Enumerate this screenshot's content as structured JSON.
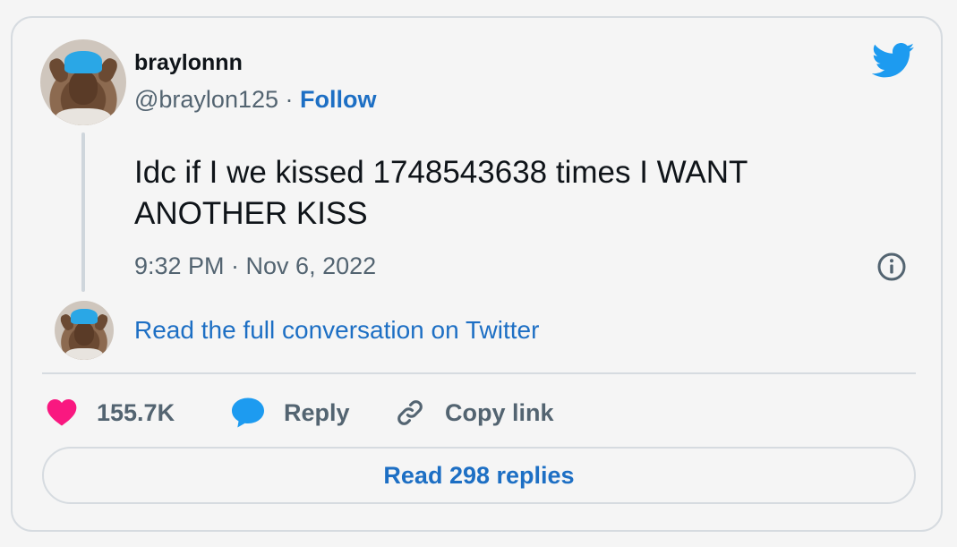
{
  "user": {
    "display_name": "braylonnn",
    "handle": "@braylon125",
    "separator": "·",
    "follow_label": "Follow"
  },
  "tweet": {
    "text": "Idc if I we kissed 1748543638 times I WANT ANOTHER KISS",
    "timestamp": "9:32 PM · Nov 6, 2022"
  },
  "conversation_link": "Read the full conversation on Twitter",
  "actions": {
    "likes_count": "155.7K",
    "reply_label": "Reply",
    "copy_link_label": "Copy link"
  },
  "read_replies_label": "Read 298 replies",
  "icons": {
    "brand": "twitter-bird-icon",
    "info": "info-icon",
    "like": "heart-icon",
    "reply": "speech-bubble-icon",
    "copy": "link-icon"
  },
  "colors": {
    "brand_blue": "#1d9bf0",
    "link_blue": "#1d6fc4",
    "heart_pink": "#f91880",
    "text_primary": "#0f1419",
    "text_secondary": "#536471",
    "border": "#d6dbe0",
    "background": "#f5f5f5"
  }
}
